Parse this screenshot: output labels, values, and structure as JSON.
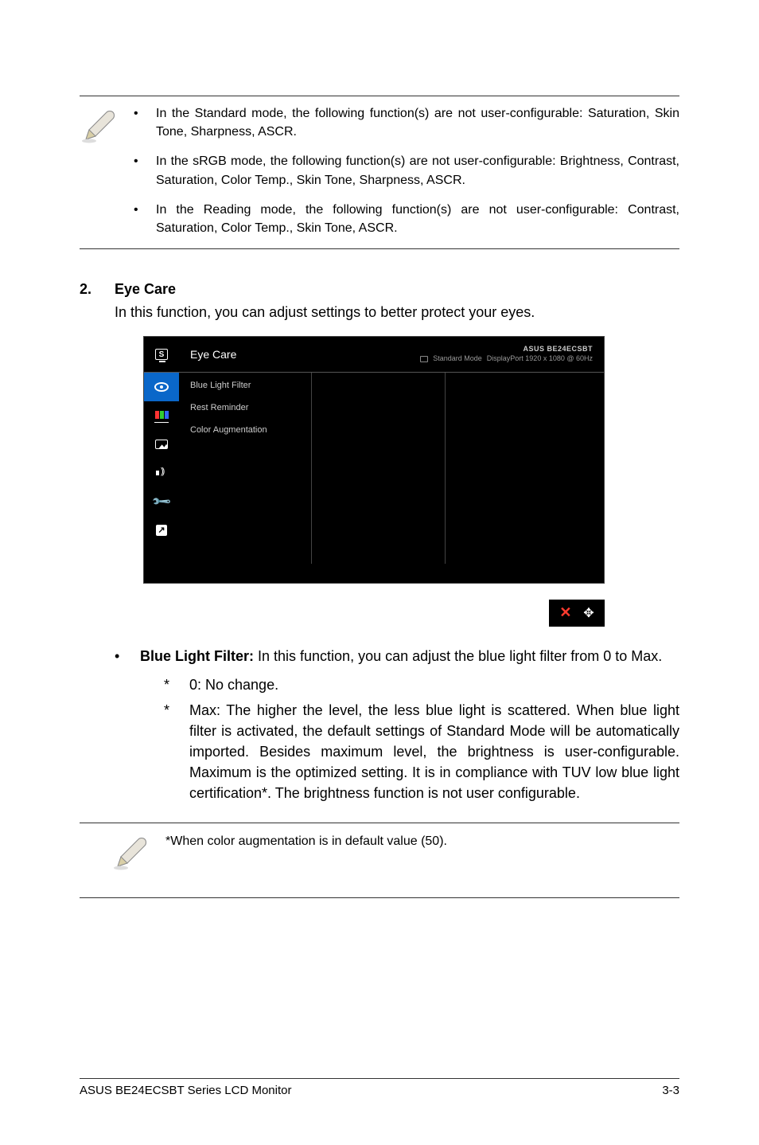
{
  "notes_top": [
    "In the Standard mode, the following function(s) are not user-configurable: Saturation, Skin Tone, Sharpness, ASCR.",
    "In the sRGB mode, the following function(s) are not user-configurable: Brightness, Contrast, Saturation, Color Temp., Skin Tone, Sharpness, ASCR.",
    "In the Reading mode, the following function(s) are not user-configurable: Contrast, Saturation, Color Temp., Skin Tone, ASCR."
  ],
  "section": {
    "num": "2.",
    "title": "Eye Care",
    "desc": "In this function, you can adjust settings to better protect your eyes."
  },
  "osd": {
    "title": "Eye Care",
    "model": "ASUS BE24ECSBT",
    "mode": "Standard Mode",
    "resolution": "DisplayPort 1920 x 1080 @ 60Hz",
    "menu": [
      "Blue Light Filter",
      "Rest Reminder",
      "Color Augmentation"
    ],
    "s_label": "S"
  },
  "buttons": {
    "close": "✕",
    "nav": "✥"
  },
  "body_bullet": {
    "lead": "Blue Light Filter:",
    "rest": " In this function, you can adjust the blue light filter from 0 to Max."
  },
  "sublist": [
    "0: No change.",
    "Max: The higher the level, the less blue light is scattered. When blue light filter is activated, the default settings of Standard Mode will be automatically imported.  Besides maximum level, the brightness is user-configurable. Maximum is the optimized setting. It is in compliance with TUV low blue light certification*. The brightness function is not user configurable."
  ],
  "note2": "*When color augmentation is in default value (50).",
  "footer": {
    "left": "ASUS BE24ECSBT Series LCD Monitor",
    "right": "3-3"
  }
}
